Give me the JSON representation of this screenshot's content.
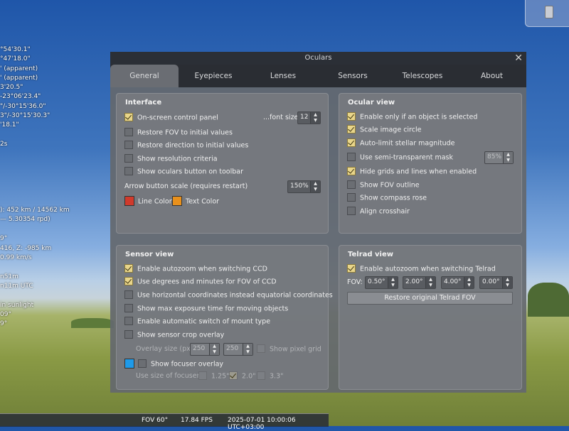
{
  "background_info": {
    "lines": [
      "°54'30.1\"",
      "°47'18.0\"",
      "' (apparent)",
      "' (apparent)",
      "3'20.5\"",
      "-23°06'23.4\"",
      "\"/-30°15'36.0\"",
      "3\"/-30°15'30.3\"",
      "'18.1\"",
      "2s",
      "): 452 km / 14562 km",
      "— 5.30354 rpd)",
      "9°",
      "416, Z: -985 km",
      "0.99 km/s",
      "n51m",
      "n11m UTC",
      "in sunlight",
      "09°",
      "9°"
    ]
  },
  "statusbar": {
    "fov": "FOV 60°",
    "fps": "17.84 FPS",
    "datetime": "2025-07-01 10:00:06 UTC+03:00"
  },
  "window": {
    "title": "Oculars",
    "close_glyph": "✕"
  },
  "tabs": [
    {
      "label": "General"
    },
    {
      "label": "Eyepieces"
    },
    {
      "label": "Lenses"
    },
    {
      "label": "Sensors"
    },
    {
      "label": "Telescopes"
    },
    {
      "label": "About"
    }
  ],
  "interface": {
    "title": "Interface",
    "items": [
      {
        "label": "On-screen control panel",
        "checked": true
      },
      {
        "label": "Restore FOV to initial values",
        "checked": false
      },
      {
        "label": "Restore direction to initial values",
        "checked": false
      },
      {
        "label": "Show resolution criteria",
        "checked": false
      },
      {
        "label": "Show oculars button on toolbar",
        "checked": false
      }
    ],
    "font_size_label": "...font size",
    "font_size_value": "12",
    "arrow_scale_label": "Arrow button scale (requires restart)",
    "arrow_scale_value": "150%",
    "line_color_label": "Line Color",
    "line_color": "#d03a2c",
    "text_color_label": "Text Color",
    "text_color": "#e8901c"
  },
  "ocular_view": {
    "title": "Ocular view",
    "items": [
      {
        "label": "Enable only if an object is selected",
        "checked": true
      },
      {
        "label": "Scale image circle",
        "checked": true
      },
      {
        "label": "Auto-limit stellar magnitude",
        "checked": true
      },
      {
        "label": "Use semi-transparent mask",
        "checked": false
      },
      {
        "label": "Hide grids and lines when enabled",
        "checked": true
      },
      {
        "label": "Show FOV outline",
        "checked": false
      },
      {
        "label": "Show compass rose",
        "checked": false
      },
      {
        "label": "Align crosshair",
        "checked": false
      }
    ],
    "mask_value": "85%"
  },
  "sensor_view": {
    "title": "Sensor view",
    "items": [
      {
        "label": "Enable autozoom when switching CCD",
        "checked": true
      },
      {
        "label": "Use degrees and minutes for FOV of CCD",
        "checked": true
      },
      {
        "label": "Use horizontal coordinates instead equatorial coordinates",
        "checked": false
      },
      {
        "label": "Show max exposure time for moving objects",
        "checked": false
      },
      {
        "label": "Enable automatic switch of mount type",
        "checked": false
      },
      {
        "label": "Show sensor crop overlay",
        "checked": false
      }
    ],
    "overlay_size_label": "Overlay size (px):",
    "overlay_w": "250",
    "overlay_h": "250",
    "pixel_grid_label": "Show pixel grid",
    "focuser_label": "Show focuser overlay",
    "focuser_color": "#1f9ae8",
    "focuser_size_label": "Use size of focuser:",
    "focuser_sizes": [
      {
        "label": "1.25\"",
        "checked": false
      },
      {
        "label": "2.0\"",
        "checked": true
      },
      {
        "label": "3.3\"",
        "checked": false
      }
    ]
  },
  "telrad_view": {
    "title": "Telrad view",
    "autozoom_label": "Enable autozoom when switching Telrad",
    "autozoom_checked": true,
    "fov_label": "FOV:",
    "fov_values": [
      "0.50°",
      "2.00°",
      "4.00°",
      "0.00°"
    ],
    "restore_button": "Restore original Telrad FOV"
  }
}
